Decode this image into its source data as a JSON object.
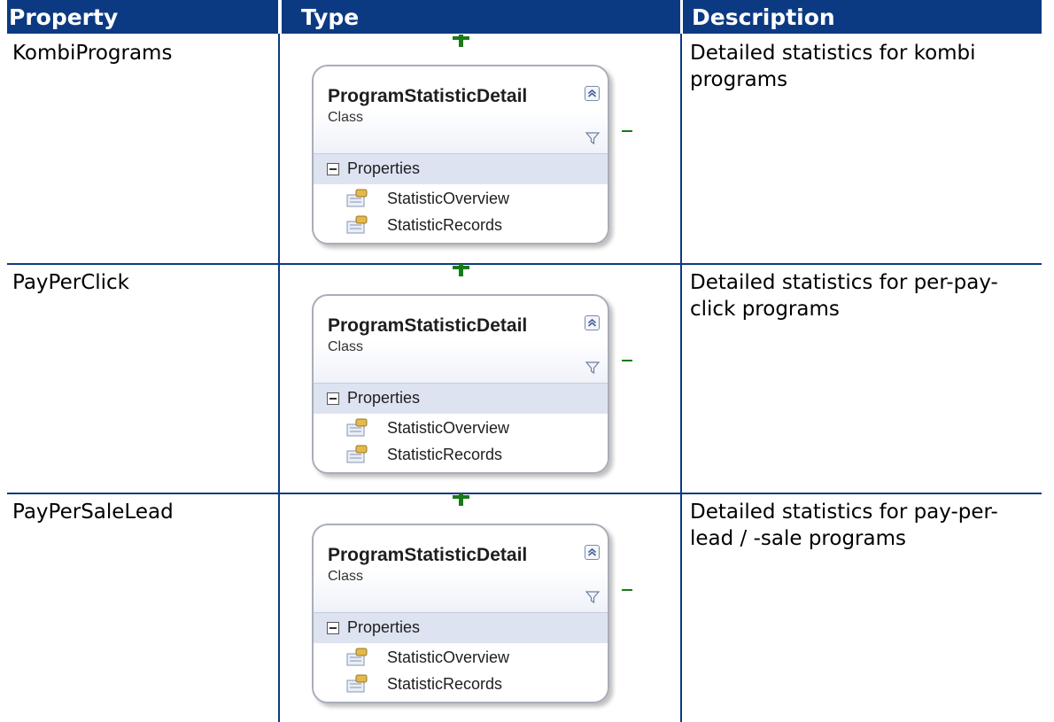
{
  "headers": {
    "property": "Property",
    "type": "Type",
    "description": "Description"
  },
  "rows": [
    {
      "property": "KombiPrograms",
      "description": "Detailed statistics for kombi programs",
      "diagram": {
        "class_name": "ProgramStatisticDetail",
        "stereotype": "Class",
        "section": "Properties",
        "properties": [
          "StatisticOverview",
          "StatisticRecords"
        ]
      }
    },
    {
      "property": "PayPerClick",
      "description": "Detailed statistics for per-pay-click programs",
      "diagram": {
        "class_name": "ProgramStatisticDetail",
        "stereotype": "Class",
        "section": "Properties",
        "properties": [
          "StatisticOverview",
          "StatisticRecords"
        ]
      }
    },
    {
      "property": "PayPerSaleLead",
      "description": "Detailed statistics for pay-per-lead / -sale programs",
      "diagram": {
        "class_name": "ProgramStatisticDetail",
        "stereotype": "Class",
        "section": "Properties",
        "properties": [
          "StatisticOverview",
          "StatisticRecords"
        ]
      }
    }
  ],
  "colors": {
    "header_bg": "#0c3a82",
    "connector": "#1a7a1a"
  },
  "icons": {
    "collapse": "double-chevron-up-icon",
    "filter": "filter-icon",
    "property": "property-icon"
  }
}
